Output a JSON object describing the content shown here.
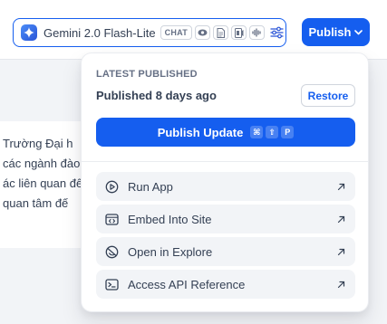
{
  "topbar": {
    "model_name": "Gemini 2.0 Flash-Lite",
    "mode_badge": "CHAT",
    "capabilities": [
      "vision-icon",
      "document-icon",
      "video-icon",
      "audio-icon"
    ],
    "publish_label": "Publish"
  },
  "background": {
    "lines": [
      "Trường Đại h",
      "các ngành đào",
      "ác liên quan đế",
      "quan tâm đế"
    ]
  },
  "panel": {
    "section_label": "LATEST PUBLISHED",
    "published_status": "Published 8 days ago",
    "restore_label": "Restore",
    "update_label": "Publish Update",
    "shortcut_keys": [
      "⌘",
      "⇧",
      "P"
    ],
    "actions": [
      {
        "label": "Run App",
        "icon": "play-icon"
      },
      {
        "label": "Embed Into Site",
        "icon": "embed-icon"
      },
      {
        "label": "Open in Explore",
        "icon": "explore-icon"
      },
      {
        "label": "Access API Reference",
        "icon": "terminal-icon"
      }
    ]
  },
  "colors": {
    "accent": "#155eef",
    "panel_bg": "#ffffff",
    "action_bg": "#f2f4f7",
    "text": "#344054",
    "muted": "#667085"
  }
}
